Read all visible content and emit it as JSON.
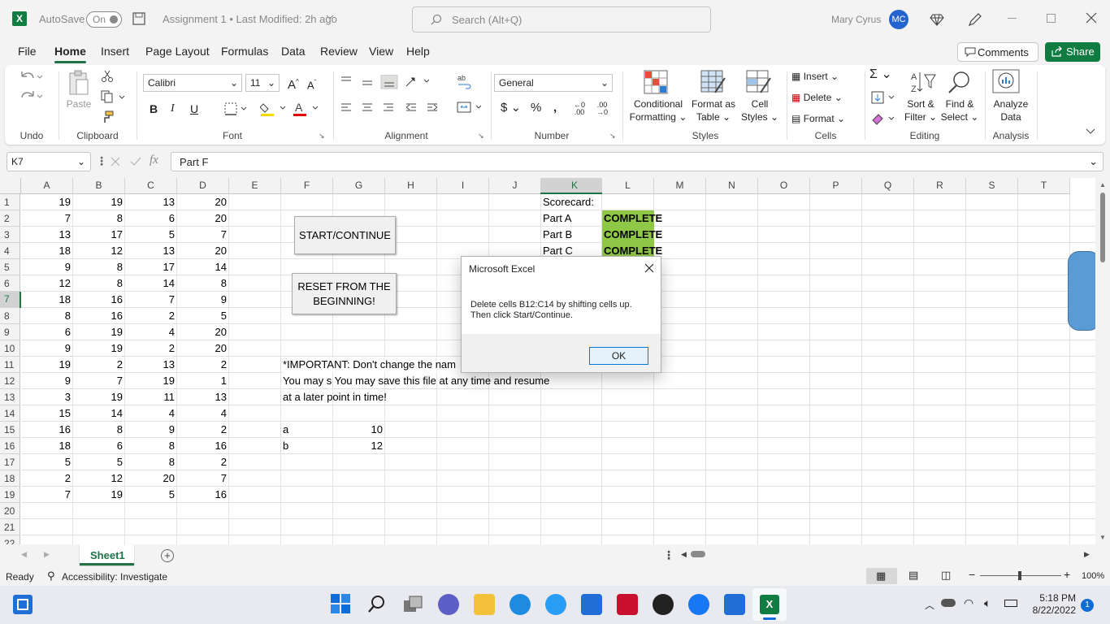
{
  "titlebar": {
    "autosave_label": "AutoSave",
    "autosave_state": "On",
    "doc_title": "Assignment 1 • Last Modified: 2h ago",
    "search_placeholder": "Search (Alt+Q)",
    "user_name": "Mary Cyrus",
    "user_initials": "MC"
  },
  "tabs": [
    "File",
    "Home",
    "Insert",
    "Page Layout",
    "Formulas",
    "Data",
    "Review",
    "View",
    "Help"
  ],
  "active_tab": "Home",
  "buttons": {
    "comments": "Comments",
    "share": "Share"
  },
  "ribbon": {
    "groups": [
      "Undo",
      "Clipboard",
      "Font",
      "Alignment",
      "Number",
      "Styles",
      "Cells",
      "Editing",
      "Analysis"
    ],
    "paste": "Paste",
    "font_name": "Calibri",
    "font_size": "11",
    "number_format": "General",
    "conditional": "Conditional",
    "formatting": "Formatting",
    "format_as": "Format as",
    "table": "Table",
    "cell": "Cell",
    "styles": "Styles",
    "insert": "Insert",
    "delete": "Delete",
    "format": "Format",
    "sort": "Sort &",
    "filter": "Filter",
    "find": "Find &",
    "select": "Select",
    "analyze": "Analyze",
    "data": "Data"
  },
  "formula_bar": {
    "name_box": "K7",
    "content": "Part F"
  },
  "columns": [
    "A",
    "B",
    "C",
    "D",
    "E",
    "F",
    "G",
    "H",
    "I",
    "J",
    "K",
    "L",
    "M",
    "N",
    "O",
    "P",
    "Q",
    "R",
    "S",
    "T"
  ],
  "rows": [
    "1",
    "2",
    "3",
    "4",
    "5",
    "6",
    "7",
    "8",
    "9",
    "10",
    "11",
    "12",
    "13",
    "14",
    "15",
    "16",
    "17",
    "18",
    "19",
    "20",
    "21",
    "22"
  ],
  "data_rows": [
    [
      "19",
      "19",
      "13",
      "20"
    ],
    [
      "7",
      "8",
      "6",
      "20"
    ],
    [
      "13",
      "17",
      "5",
      "7"
    ],
    [
      "18",
      "12",
      "13",
      "20"
    ],
    [
      "9",
      "8",
      "17",
      "14"
    ],
    [
      "12",
      "8",
      "14",
      "8"
    ],
    [
      "18",
      "16",
      "7",
      "9"
    ],
    [
      "8",
      "16",
      "2",
      "5"
    ],
    [
      "6",
      "19",
      "4",
      "20"
    ],
    [
      "9",
      "19",
      "2",
      "20"
    ],
    [
      "19",
      "2",
      "13",
      "2"
    ],
    [
      "9",
      "7",
      "19",
      "1"
    ],
    [
      "3",
      "19",
      "11",
      "13"
    ],
    [
      "15",
      "14",
      "4",
      "4"
    ],
    [
      "16",
      "8",
      "9",
      "2"
    ],
    [
      "18",
      "6",
      "8",
      "16"
    ],
    [
      "5",
      "5",
      "8",
      "2"
    ],
    [
      "2",
      "12",
      "20",
      "7"
    ],
    [
      "7",
      "19",
      "5",
      "16"
    ]
  ],
  "scorecard": {
    "title": "Scorecard:",
    "parts": [
      "Part A",
      "Part B",
      "Part C"
    ],
    "status": "COMPLETE"
  },
  "shapes": {
    "start": "START/CONTINUE",
    "reset": "RESET FROM THE BEGINNING!"
  },
  "notes": [
    "*IMPORTANT: Don't change the nam",
    "You may s You may save this file at any time and resume",
    "at a later point in time!"
  ],
  "vars": [
    [
      "a",
      "10"
    ],
    [
      "b",
      "12"
    ]
  ],
  "dialog": {
    "title": "Microsoft Excel",
    "message": "Delete cells B12:C14 by shifting cells up. Then click Start/Continue.",
    "ok": "OK"
  },
  "sheet_tab": "Sheet1",
  "status": {
    "ready": "Ready",
    "accessibility": "Accessibility: Investigate",
    "zoom": "100%"
  },
  "clock": {
    "time": "5:18 PM",
    "date": "8/22/2022",
    "notifications": "1"
  },
  "colors": {
    "excel_green": "#107c41",
    "complete_fill": "#8fc746",
    "accent": "#217346"
  }
}
